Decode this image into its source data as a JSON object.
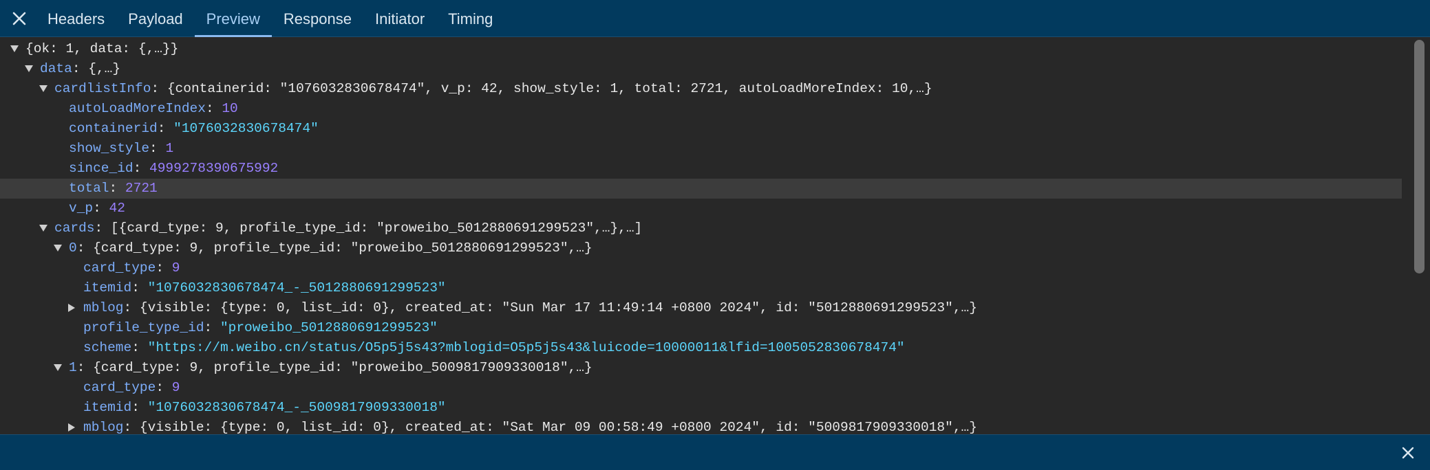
{
  "tabs": [
    "Headers",
    "Payload",
    "Preview",
    "Response",
    "Initiator",
    "Timing"
  ],
  "active_tab": "Preview",
  "tree": [
    {
      "indent": 0,
      "toggle": "down",
      "key": "",
      "summary": "{ok: 1, data: {,…}}"
    },
    {
      "indent": 1,
      "toggle": "down",
      "key": "data",
      "summary": "{,…}"
    },
    {
      "indent": 2,
      "toggle": "down",
      "key": "cardlistInfo",
      "summary": "{containerid: \"1076032830678474\", v_p: 42, show_style: 1, total: 2721, autoLoadMoreIndex: 10,…}"
    },
    {
      "indent": 3,
      "toggle": "",
      "key": "autoLoadMoreIndex",
      "value": "10",
      "vtype": "number"
    },
    {
      "indent": 3,
      "toggle": "",
      "key": "containerid",
      "value": "\"1076032830678474\"",
      "vtype": "string"
    },
    {
      "indent": 3,
      "toggle": "",
      "key": "show_style",
      "value": "1",
      "vtype": "number"
    },
    {
      "indent": 3,
      "toggle": "",
      "key": "since_id",
      "value": "4999278390675992",
      "vtype": "number"
    },
    {
      "indent": 3,
      "toggle": "",
      "key": "total",
      "value": "2721",
      "vtype": "number",
      "highlight": true
    },
    {
      "indent": 3,
      "toggle": "",
      "key": "v_p",
      "value": "42",
      "vtype": "number"
    },
    {
      "indent": 2,
      "toggle": "down",
      "key": "cards",
      "summary": "[{card_type: 9, profile_type_id: \"proweibo_5012880691299523\",…},…]"
    },
    {
      "indent": 3,
      "toggle": "down",
      "key": "0",
      "summary": "{card_type: 9, profile_type_id: \"proweibo_5012880691299523\",…}"
    },
    {
      "indent": 4,
      "toggle": "",
      "key": "card_type",
      "value": "9",
      "vtype": "number"
    },
    {
      "indent": 4,
      "toggle": "",
      "key": "itemid",
      "value": "\"1076032830678474_-_5012880691299523\"",
      "vtype": "string"
    },
    {
      "indent": 4,
      "toggle": "right",
      "key": "mblog",
      "summary": "{visible: {type: 0, list_id: 0}, created_at: \"Sun Mar 17 11:49:14 +0800 2024\", id: \"5012880691299523\",…}"
    },
    {
      "indent": 4,
      "toggle": "",
      "key": "profile_type_id",
      "value": "\"proweibo_5012880691299523\"",
      "vtype": "string"
    },
    {
      "indent": 4,
      "toggle": "",
      "key": "scheme",
      "value": "\"https://m.weibo.cn/status/O5p5j5s43?mblogid=O5p5j5s43&luicode=10000011&lfid=1005052830678474\"",
      "vtype": "string"
    },
    {
      "indent": 3,
      "toggle": "down",
      "key": "1",
      "summary": "{card_type: 9, profile_type_id: \"proweibo_5009817909330018\",…}"
    },
    {
      "indent": 4,
      "toggle": "",
      "key": "card_type",
      "value": "9",
      "vtype": "number"
    },
    {
      "indent": 4,
      "toggle": "",
      "key": "itemid",
      "value": "\"1076032830678474_-_5009817909330018\"",
      "vtype": "string"
    },
    {
      "indent": 4,
      "toggle": "right",
      "key": "mblog",
      "summary": "{visible: {type: 0, list_id: 0}, created_at: \"Sat Mar 09 00:58:49 +0800 2024\", id: \"5009817909330018\",…}"
    }
  ],
  "colors": {
    "toolbar": "#023a5e",
    "panel": "#282828",
    "key": "#7cacf8",
    "string": "#5cd5fb",
    "number": "#9980ff",
    "text": "#e8e8e8"
  },
  "icons": {
    "close_tab": "close-icon",
    "close_drawer": "close-icon",
    "expanded": "triangle-down-icon",
    "collapsed": "triangle-right-icon"
  }
}
